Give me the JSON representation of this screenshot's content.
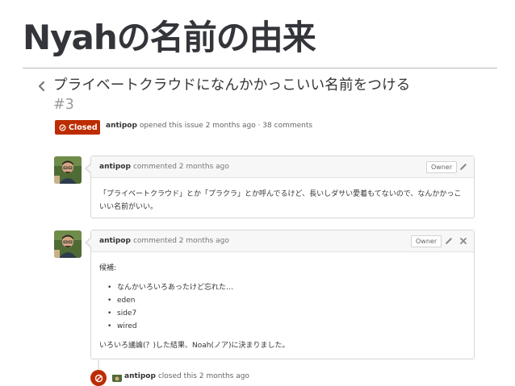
{
  "slide": {
    "title": "Nyahの名前の由来"
  },
  "issue": {
    "title": "プライベートクラウドになんかかっこいい名前をつける",
    "number": "#3",
    "state": "Closed",
    "author": "antipop",
    "meta_text": "opened this issue 2 months ago · 38 comments"
  },
  "comments": [
    {
      "author": "antipop",
      "action": "commented 2 months ago",
      "owner_label": "Owner",
      "body": "「プライベートクラウド」とか「プラクラ」とか呼んでるけど、長いしダサい愛着もてないので、なんかかっこいい名前がいい。"
    },
    {
      "author": "antipop",
      "action": "commented 2 months ago",
      "owner_label": "Owner",
      "intro": "候補:",
      "candidates": [
        "なんかいろいろあったけど忘れた…",
        "eden",
        "side7",
        "wired"
      ],
      "conclusion": "いろいろ議論(？)した結果、Noah(ノア)に決まりました。"
    }
  ],
  "event": {
    "author": "antipop",
    "text": "closed this 2 months ago"
  },
  "colors": {
    "closed_red": "#bd2c00",
    "title_dark": "#33353a"
  },
  "icons": [
    "chevron-left-icon",
    "issue-closed-icon",
    "pencil-icon",
    "close-icon",
    "circle-slash-icon"
  ]
}
